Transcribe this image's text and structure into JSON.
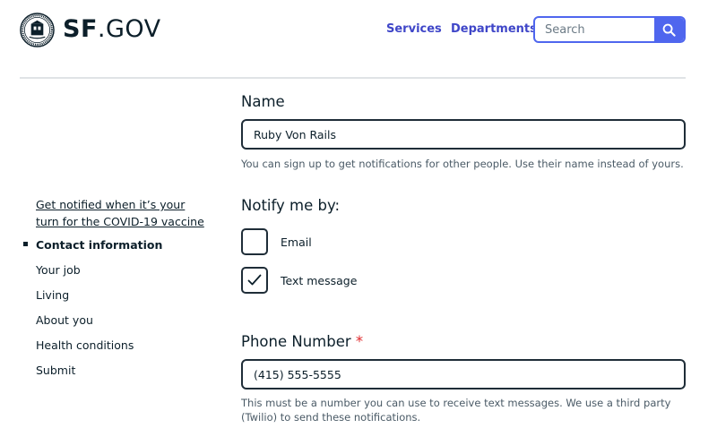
{
  "header": {
    "brand_bold": "SF",
    "brand_rest": ".GOV",
    "nav": {
      "services": "Services",
      "departments": "Departments"
    },
    "search": {
      "placeholder": "Search",
      "value": ""
    },
    "icons": {
      "seal": "city-seal-logo",
      "search": "search-icon"
    },
    "colors": {
      "accent": "#4f66ee",
      "link": "#3f46c8"
    }
  },
  "sidebar": {
    "items": [
      {
        "label_line1": "Get notified when it’s your",
        "label_line2": "turn for the COVID-19 vaccine"
      },
      {
        "label": "Contact information",
        "active": true
      },
      {
        "label": "Your job"
      },
      {
        "label": "Living"
      },
      {
        "label": "About you"
      },
      {
        "label": "Health conditions"
      },
      {
        "label": "Submit"
      }
    ]
  },
  "form": {
    "name": {
      "label": "Name",
      "value": "Ruby Von Rails",
      "help": "You can sign up to get notifications for other people. Use their name instead of yours."
    },
    "notify": {
      "label": "Notify me by:",
      "options": [
        {
          "label": "Email",
          "checked": false
        },
        {
          "label": "Text message",
          "checked": true
        }
      ]
    },
    "phone": {
      "label": "Phone Number",
      "required_marker": "*",
      "value": "(415) 555-5555",
      "help": "This must be a number you can use to receive text messages. We use a third party (Twilio) to send these notifications."
    },
    "colors": {
      "required": "#e0292d",
      "border": "#1f2d38"
    }
  }
}
